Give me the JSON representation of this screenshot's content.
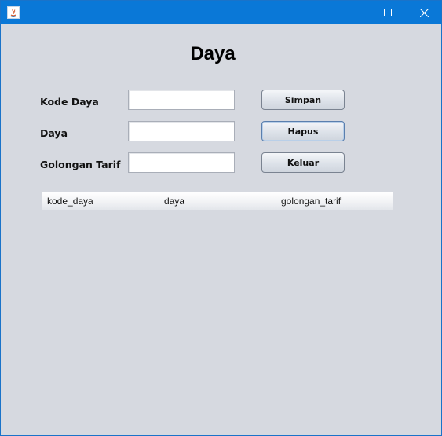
{
  "window": {
    "controls": {
      "minimize_icon": "minimize-icon",
      "maximize_icon": "maximize-icon",
      "close_icon": "close-icon"
    },
    "titlebar_color": "#0a78d7"
  },
  "form": {
    "title": "Daya",
    "fields": [
      {
        "label": "Kode Daya",
        "value": ""
      },
      {
        "label": "Daya",
        "value": ""
      },
      {
        "label": "Golongan Tarif",
        "value": ""
      }
    ],
    "buttons": {
      "simpan": "Simpan",
      "hapus": "Hapus",
      "keluar": "Keluar"
    }
  },
  "table": {
    "columns": [
      "kode_daya",
      "daya",
      "golongan_tarif"
    ],
    "rows": []
  }
}
